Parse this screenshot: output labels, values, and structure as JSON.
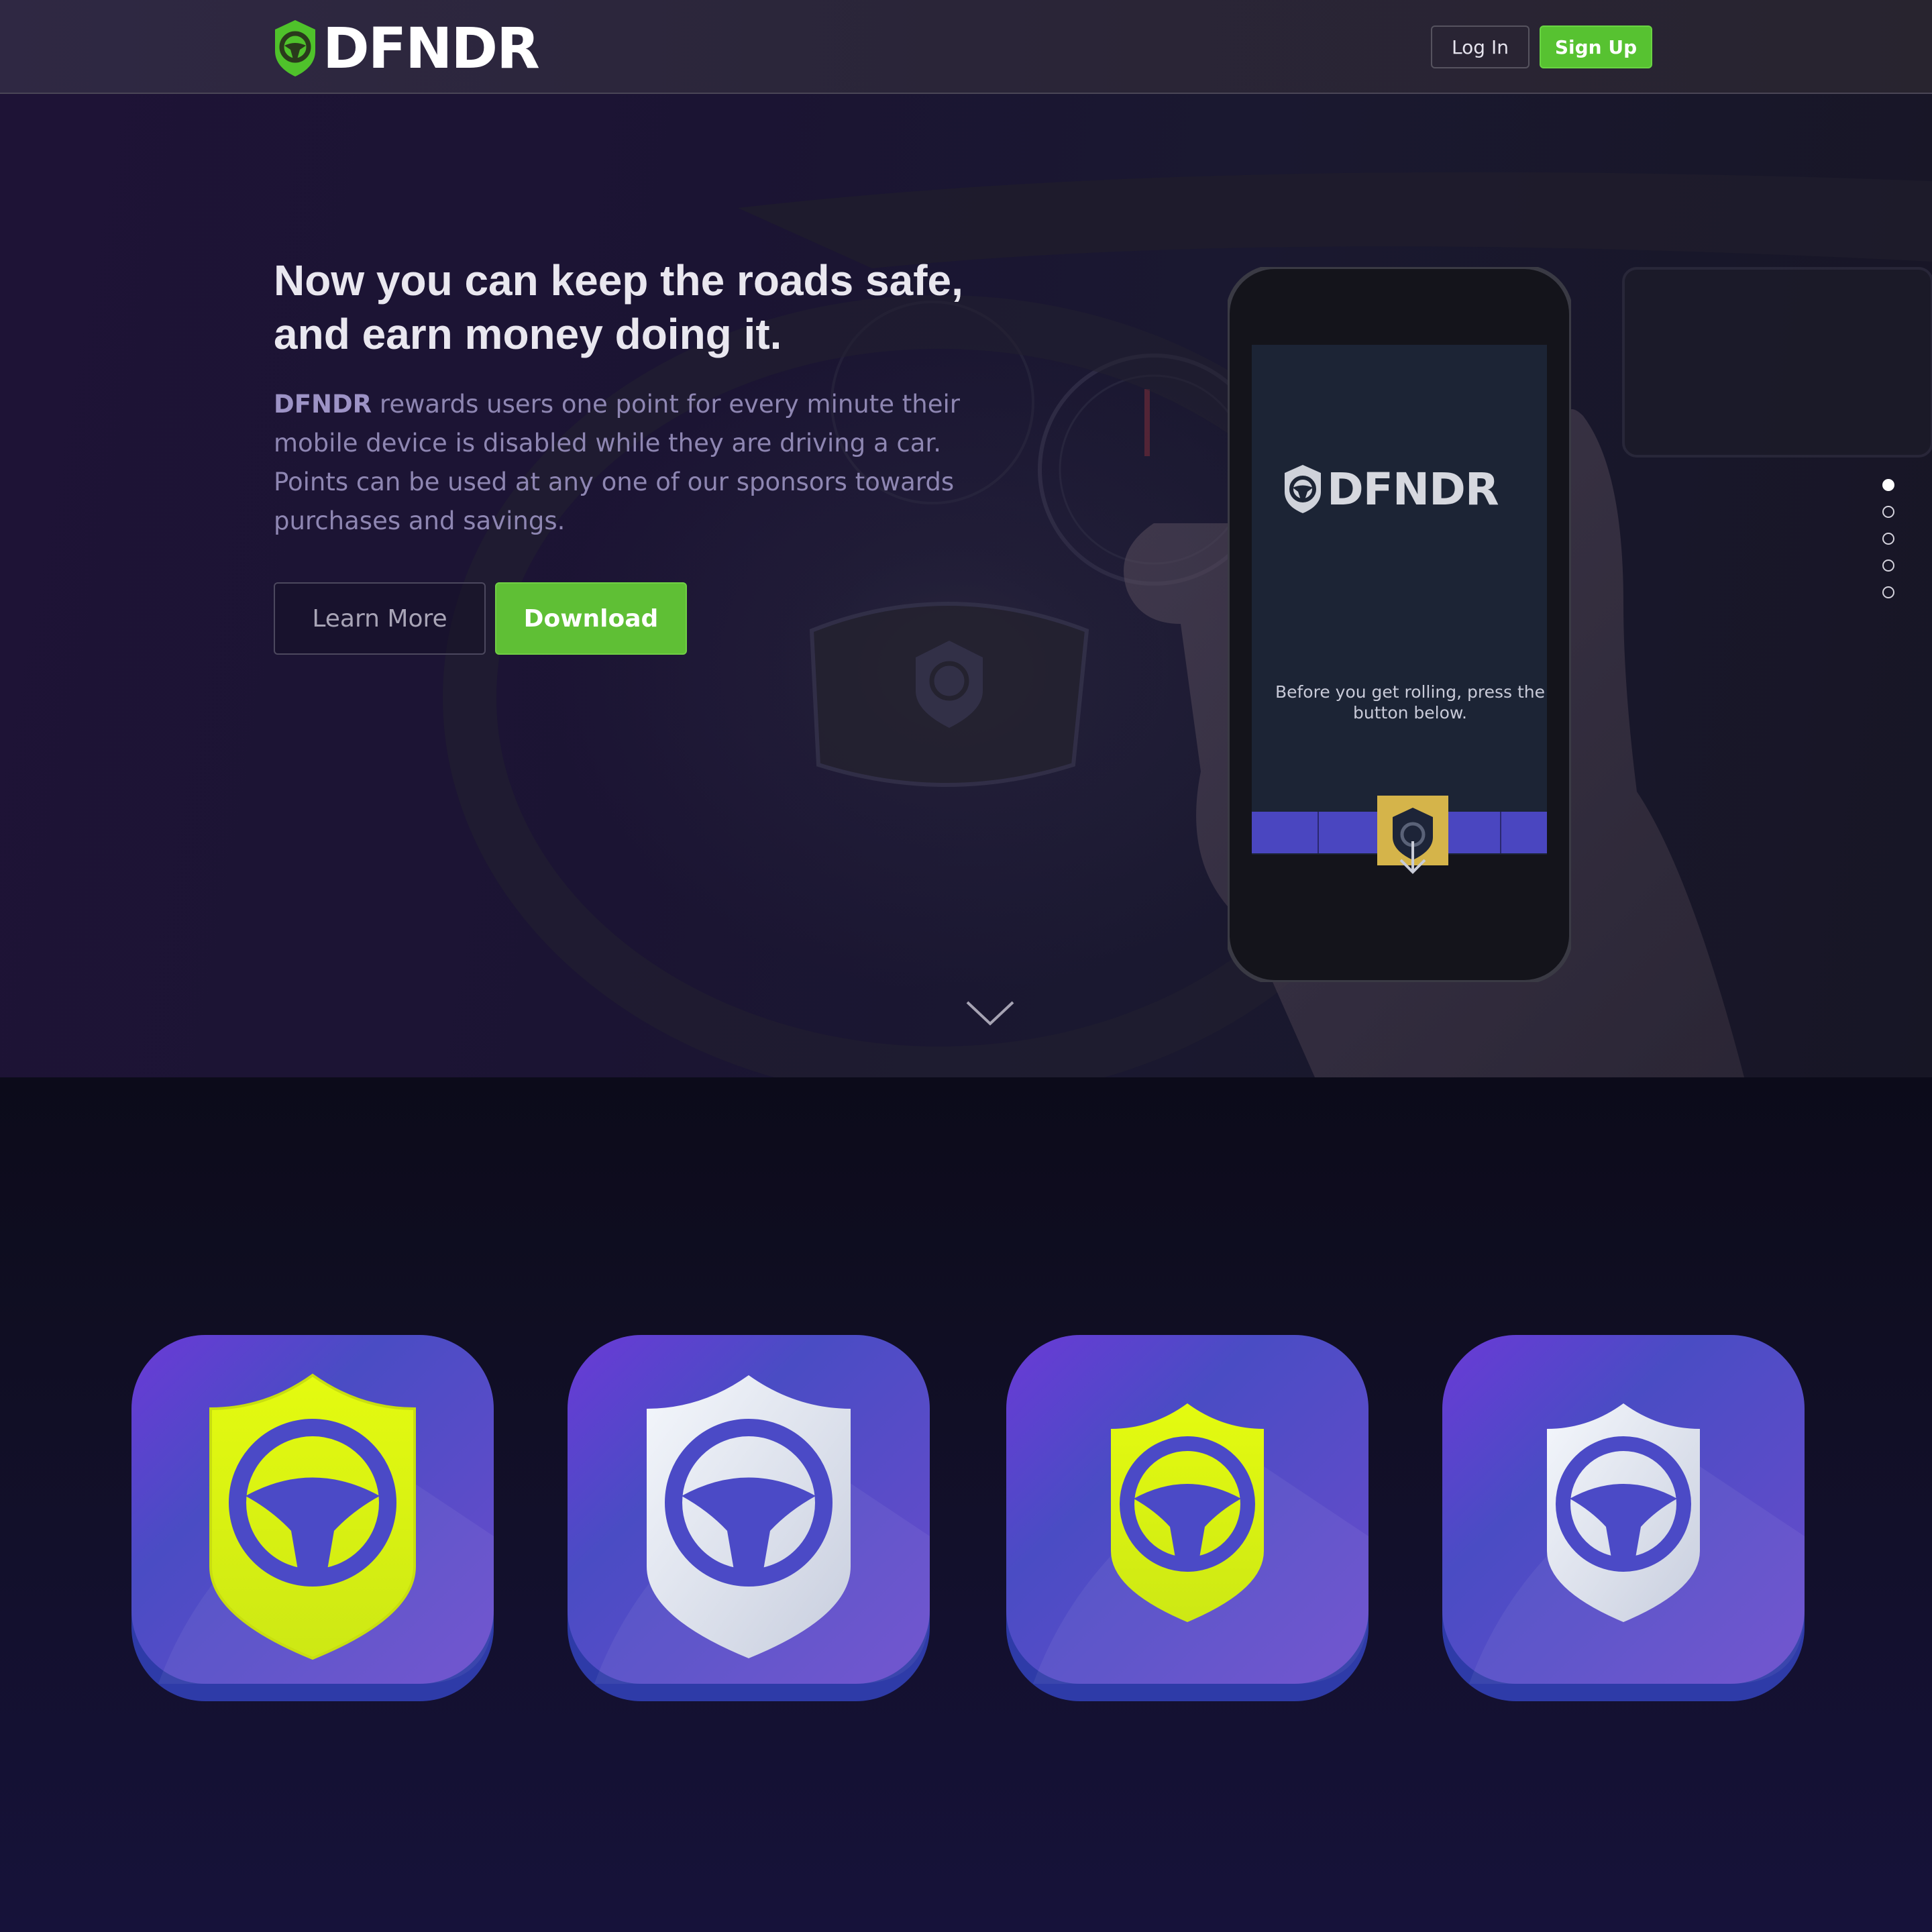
{
  "nav": {
    "logo_text": "DFNDR",
    "login_label": "Log In",
    "signup_label": "Sign Up"
  },
  "hero": {
    "title": "Now you can keep the roads safe, and earn money doing it.",
    "desc_brand": "DFNDR",
    "desc_body": " rewards users one point for every minute their mobile device is disabled while they are driving a car. Points can be used at any one of our sponsors towards purchases and savings.",
    "learn_more_label": "Learn More",
    "download_label": "Download",
    "pager_count": 5,
    "pager_active": 0,
    "scroll_icon": "chevron-down-icon"
  },
  "phone": {
    "logo_text": "DFNDR",
    "message": "Before you get rolling, press the button below."
  },
  "app_icons": [
    {
      "name": "app-icon-yellow-large",
      "shield": "yellow",
      "size": "large"
    },
    {
      "name": "app-icon-white-large",
      "shield": "white",
      "size": "large"
    },
    {
      "name": "app-icon-yellow-small",
      "shield": "yellow",
      "size": "small"
    },
    {
      "name": "app-icon-white-small",
      "shield": "white",
      "size": "small"
    }
  ],
  "colors": {
    "accent_green": "#5fbf35",
    "icon_purple": "#5a45c8",
    "shield_yellow": "#dcf414",
    "shield_white": "#e8ecf4"
  }
}
